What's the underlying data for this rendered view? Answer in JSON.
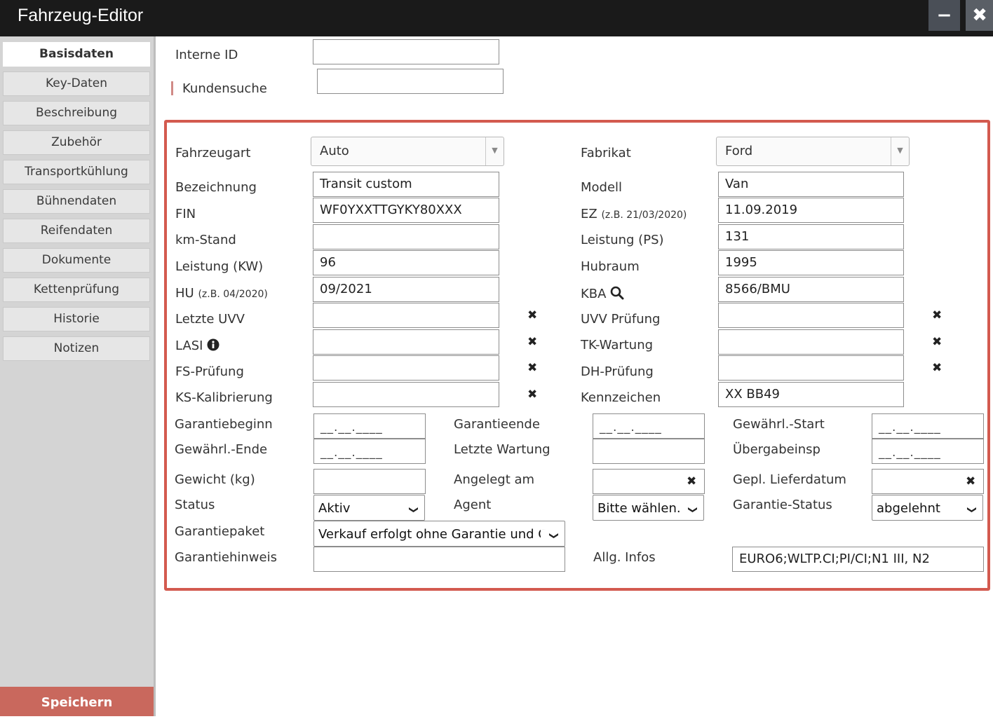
{
  "window": {
    "title": "Fahrzeug-Editor",
    "minimize_label": "−",
    "close_label": "✖"
  },
  "sidebar": {
    "items": [
      {
        "label": "Basisdaten"
      },
      {
        "label": "Key-Daten"
      },
      {
        "label": "Beschreibung"
      },
      {
        "label": "Zubehör"
      },
      {
        "label": "Transportkühlung"
      },
      {
        "label": "Bühnendaten"
      },
      {
        "label": "Reifendaten"
      },
      {
        "label": "Dokumente"
      },
      {
        "label": "Kettenprüfung"
      },
      {
        "label": "Historie"
      },
      {
        "label": "Notizen"
      }
    ],
    "save_label": "Speichern"
  },
  "top": {
    "interne_id_label": "Interne ID",
    "interne_id_value": "",
    "kundensuche_label": "Kundensuche",
    "kundensuche_value": ""
  },
  "vehicle": {
    "fahrzeugart_label": "Fahrzeugart",
    "fahrzeugart_value": "Auto",
    "fabrikat_label": "Fabrikat",
    "fabrikat_value": "Ford",
    "bezeichnung_label": "Bezeichnung",
    "bezeichnung_value": "Transit custom",
    "modell_label": "Modell",
    "modell_value": "Van",
    "fin_label": "FIN",
    "fin_value": "WF0YXXTTGYKY80XXX",
    "ez_label": "EZ",
    "ez_hint": "(z.B. 21/03/2020)",
    "ez_value": "11.09.2019",
    "km_label": "km-Stand",
    "km_value": "",
    "ps_label": "Leistung (PS)",
    "ps_value": "131",
    "kw_label": "Leistung (KW)",
    "kw_value": "96",
    "hubraum_label": "Hubraum",
    "hubraum_value": "1995",
    "hu_label": "HU",
    "hu_hint": "(z.B. 04/2020)",
    "hu_value": "09/2021",
    "kba_label": "KBA",
    "kba_value": "8566/BMU",
    "letzte_uvv_label": "Letzte UVV",
    "letzte_uvv_value": "",
    "uvv_pruefung_label": "UVV Prüfung",
    "uvv_pruefung_value": "",
    "lasi_label": "LASI",
    "lasi_value": "",
    "tk_wartung_label": "TK-Wartung",
    "tk_wartung_value": "",
    "fs_pruefung_label": "FS-Prüfung",
    "fs_pruefung_value": "",
    "dh_pruefung_label": "DH-Prüfung",
    "dh_pruefung_value": "",
    "ks_kalibrierung_label": "KS-Kalibrierung",
    "ks_kalibrierung_value": "",
    "kennzeichen_label": "Kennzeichen",
    "kennzeichen_value": "XX BB49",
    "clear_glyph": "✖"
  },
  "warranty": {
    "garantiebeginn_label": "Garantiebeginn",
    "garantiebeginn_value": "__.__.____",
    "garantieende_label": "Garantieende",
    "garantieende_value": "__.__.____",
    "gewaehrl_start_label": "Gewährl.-Start",
    "gewaehrl_start_value": "__.__.____",
    "gewaehrl_ende_label": "Gewährl.-Ende",
    "gewaehrl_ende_value": "__.__.____",
    "letzte_wartung_label": "Letzte Wartung",
    "letzte_wartung_value": "",
    "uebergabeinsp_label": "Übergabeinsp",
    "uebergabeinsp_value": "__.__.____",
    "gewicht_label": "Gewicht (kg)",
    "gewicht_value": "",
    "angelegt_label": "Angelegt am",
    "angelegt_value": "",
    "lieferdatum_label": "Gepl. Lieferdatum",
    "lieferdatum_value": "",
    "status_label": "Status",
    "status_value": "Aktiv",
    "agent_label": "Agent",
    "agent_value": "Bitte wählen...",
    "garantie_status_label": "Garantie-Status",
    "garantie_status_value": "abgelehnt",
    "garantiepaket_label": "Garantiepaket",
    "garantiepaket_value": "Verkauf erfolgt ohne Garantie und Gew",
    "garantiehinweis_label": "Garantiehinweis",
    "garantiehinweis_value": "",
    "allg_infos_label": "Allg. Infos",
    "allg_infos_value": "EURO6;WLTP.CI;PI/CI;N1 III, N2"
  },
  "colors": {
    "titlebar": "#1a1a1a",
    "sidebar": "#d4d4d4",
    "save_button": "#c9685d",
    "frame_border": "#d35a4f"
  },
  "icons": {
    "kba": "search-icon",
    "lasi": "info-icon",
    "clear": "clear-x-icon",
    "dropdown": "chevron-down-icon"
  }
}
